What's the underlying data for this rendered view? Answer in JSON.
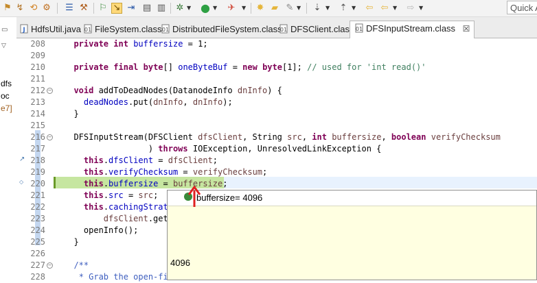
{
  "toolbar": {
    "quick_access": "Quick A",
    "colors": {
      "run_green": "#2ea043",
      "debug_red": "#d04a3a",
      "folder_yellow": "#e5b53a"
    }
  },
  "left_panel": {
    "items": [
      "dfs",
      "oc",
      "e7]"
    ]
  },
  "tabs": [
    {
      "label": "HdfsUtil.java",
      "icon": "java-file-icon",
      "active": false
    },
    {
      "label": "FileSystem.class",
      "icon": "class-file-icon",
      "active": false
    },
    {
      "label": "DistributedFileSystem.class",
      "icon": "class-file-icon",
      "active": false
    },
    {
      "label": "DFSClient.class",
      "icon": "class-file-icon",
      "active": false
    },
    {
      "label": "DFSInputStream.class",
      "icon": "class-file-icon",
      "active": true
    }
  ],
  "editor": {
    "line_numbers": [
      "208",
      "209",
      "210",
      "211",
      "212",
      "213",
      "214",
      "215",
      "216",
      "217",
      "218",
      "219",
      "220",
      "221",
      "222",
      "223",
      "224",
      "225",
      "226",
      "227",
      "228"
    ],
    "current_line": "220",
    "colors": {
      "keyword": "#7f0055",
      "field": "#0000c0",
      "comment": "#3f7f5f",
      "javadoc": "#3f5fbf",
      "debug_highlight": "#c6e6a0"
    }
  },
  "hover": {
    "variable": "buffersize",
    "value": "4096",
    "detail": "4096"
  }
}
